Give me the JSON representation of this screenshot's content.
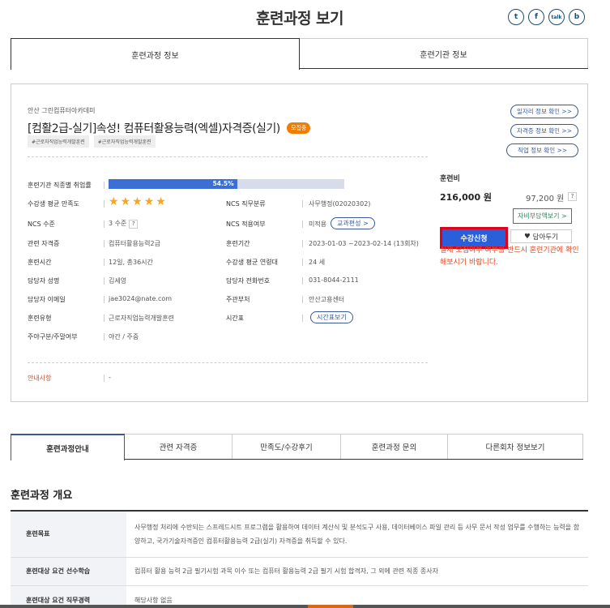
{
  "page_title": "훈련과정 보기",
  "share": {
    "items": [
      {
        "name": "twitter",
        "glyph": "t"
      },
      {
        "name": "facebook",
        "glyph": "f"
      },
      {
        "name": "talk",
        "glyph": "talk"
      },
      {
        "name": "band",
        "glyph": "b"
      }
    ]
  },
  "top_tabs": [
    "훈련과정 정보",
    "훈련기관 정보"
  ],
  "course": {
    "institution": "안산 그린컴퓨터아카데미",
    "title": "[컴활2급-실기]속성! 컴퓨터활용능력(엑셀)자격증(실기)",
    "badge": "모집중",
    "tags": [
      "#근로자직업능력개발훈련",
      "#근로자직업능력개발훈련"
    ]
  },
  "side_links": [
    "일자리 정보 확인 >>",
    "자격증 정보 확인 >>",
    "직업 정보 확인 >>"
  ],
  "info": {
    "employment_rate_label": "훈련기관 직종별 취업률",
    "employment_rate_value": "54.5%",
    "employment_rate_fraction": 0.545,
    "satisfaction_label": "수강생 평균 만족도",
    "satisfaction_stars": 5,
    "ncs_level_label": "NCS 수준",
    "ncs_level_value": "3 수준",
    "related_cert_label": "관련 자격증",
    "related_cert_value": "컴퓨터활용능력2급",
    "hours_label": "훈련시간",
    "hours_value": "12일, 총36시간",
    "contact_name_label": "담당자 성명",
    "contact_name_value": "김세영",
    "contact_email_label": "담당자 이메일",
    "contact_email_value": "jae3024@nate.com",
    "type_label": "훈련유형",
    "type_value": "근로자직업능력개발훈련",
    "day_label": "주야구분/주말여부",
    "day_value": "야간 / 주중",
    "ncs_class_label": "NCS 직무분류",
    "ncs_class_value": "사무행정(02020302)",
    "ncs_apply_label": "NCS 적용여부",
    "ncs_apply_value": "미적용",
    "curriculum_btn": "교과편성 >",
    "period_label": "훈련기간",
    "period_value": "2023-01-03 ~2023-02-14 (13회차)",
    "age_label": "수강생 평균 연령대",
    "age_value": "24 세",
    "phone_label": "담당자 전화번호",
    "phone_value": "031-8044-2111",
    "org_label": "주관부처",
    "org_value": "안산고용센터",
    "timetable_label": "시간표",
    "timetable_btn": "시간표보기"
  },
  "guide": {
    "label": "안내사항",
    "value": "-"
  },
  "fee": {
    "label": "훈련비",
    "value": "216,000 원",
    "self_pay": "97,200 원",
    "self_pay_btn": "자비부담액보기 >",
    "apply_btn": "수강신청",
    "wish_btn": "담아두기",
    "notice": "실제 모집여부 여부를 반드시 훈련기관에 확인해보시기 바랍니다."
  },
  "sub_tabs": [
    "훈련과정안내",
    "관련 자격증",
    "만족도/수강후기",
    "훈련과정 문의",
    "다른회차 정보보기"
  ],
  "overview": {
    "title": "훈련과정 개요",
    "rows": [
      {
        "head": "훈련목표",
        "body": "사무행정 처리에 수반되는 스프레드시트 프로그램을 활용하여 데이터 계산식 및 분석도구 사용, 데이터베이스 파일 관리 등 사무 문서 작성 업무를 수행하는 능력을 함양하고, 국가기술자격증인 컴퓨터활용능력 2급(실기) 자격증을 취득할 수 있다."
      },
      {
        "head": "훈련대상 요건 선수학습",
        "body": "컴퓨터 활용 능력 2급 필기시험 과목 이수 또는 컴퓨터 활용능력 2급 필기 시험 합격자, 그 외에 관련 직종 종사자"
      },
      {
        "head": "훈련대상 요건 직무경력",
        "body": "해당사항 없음"
      }
    ]
  }
}
